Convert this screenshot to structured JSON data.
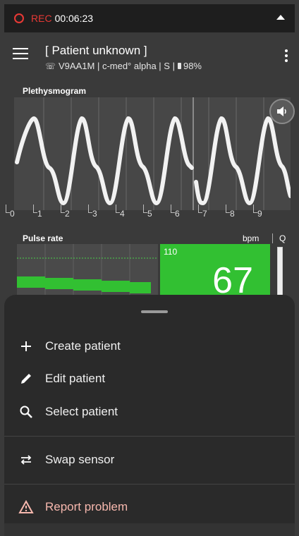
{
  "statusbar": {
    "rec_label": "REC",
    "rec_time": "00:06:23"
  },
  "header": {
    "title": "[ Patient unknown ]",
    "subtitle_id": "V9AA1M",
    "subtitle_device": "c-med° alpha",
    "subtitle_mode": "S",
    "battery": "98%"
  },
  "pleth": {
    "label": "Plethysmogram",
    "ticks": [
      "0",
      "1",
      "2",
      "3",
      "4",
      "5",
      "6",
      "7",
      "8",
      "9"
    ]
  },
  "pulse": {
    "label": "Pulse rate",
    "unit": "bpm",
    "quality_label": "Q",
    "upper_limit": "110",
    "value": "67"
  },
  "sheet": {
    "items": [
      {
        "label": "Create patient",
        "icon": "plus-icon"
      },
      {
        "label": "Edit patient",
        "icon": "pencil-icon"
      },
      {
        "label": "Select patient",
        "icon": "search-icon"
      },
      {
        "label": "Swap sensor",
        "icon": "swap-icon"
      },
      {
        "label": "Report problem",
        "icon": "warning-icon"
      }
    ]
  },
  "colors": {
    "accent_green": "#32c032",
    "rec_red": "#e53935",
    "danger_text": "#f7b8ae"
  }
}
